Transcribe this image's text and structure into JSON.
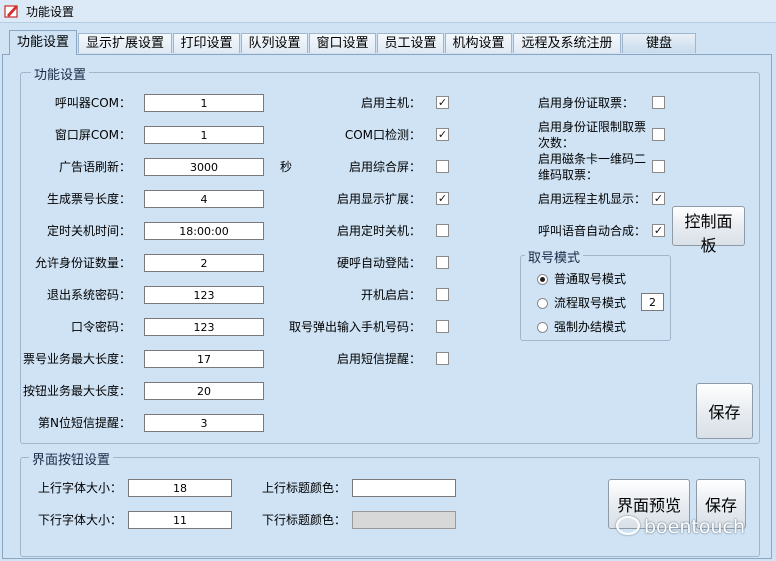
{
  "window": {
    "title": "功能设置"
  },
  "tabs": [
    {
      "label": "功能设置"
    },
    {
      "label": "显示扩展设置"
    },
    {
      "label": "打印设置"
    },
    {
      "label": "队列设置"
    },
    {
      "label": "窗口设置"
    },
    {
      "label": "员工设置"
    },
    {
      "label": "机构设置"
    },
    {
      "label": "远程及系统注册"
    },
    {
      "label": "键盘"
    }
  ],
  "function_group": {
    "title": "功能设置",
    "fields": [
      {
        "label": "呼叫器COM：",
        "value": "1"
      },
      {
        "label": "窗口屏COM：",
        "value": "1"
      },
      {
        "label": "广告语刷新：",
        "value": "3000",
        "unit": "秒"
      },
      {
        "label": "生成票号长度：",
        "value": "4"
      },
      {
        "label": "定时关机时间：",
        "value": "18:00:00"
      },
      {
        "label": "允许身份证数量：",
        "value": "2"
      },
      {
        "label": "退出系统密码：",
        "value": "123"
      },
      {
        "label": "口令密码：",
        "value": "123"
      },
      {
        "label": "票号业务最大长度：",
        "value": "17"
      },
      {
        "label": "按钮业务最大长度：",
        "value": "20"
      },
      {
        "label": "第N位短信提醒：",
        "value": "3"
      }
    ],
    "mid_checks": [
      {
        "label": "启用主机：",
        "checked": true
      },
      {
        "label": "COM口检测：",
        "checked": true
      },
      {
        "label": "启用综合屏：",
        "checked": false
      },
      {
        "label": "启用显示扩展：",
        "checked": true
      },
      {
        "label": "启用定时关机：",
        "checked": false
      },
      {
        "label": "硬呼自动登陆：",
        "checked": false
      },
      {
        "label": "开机启启：",
        "checked": false
      },
      {
        "label": "取号弹出输入手机号码：",
        "checked": false
      },
      {
        "label": "启用短信提醒：",
        "checked": false
      }
    ],
    "right_checks": [
      {
        "label1": "启用身份证取票：",
        "label2": "",
        "checked": false
      },
      {
        "label1": "启用身份证限制取票",
        "label2": "次数：",
        "checked": false
      },
      {
        "label1": "启用磁条卡一维码二",
        "label2": "维码取票：",
        "checked": false
      },
      {
        "label1": "启用远程主机显示：",
        "label2": "",
        "checked": true
      },
      {
        "label1": "呼叫语音自动合成：",
        "label2": "",
        "checked": true
      }
    ],
    "control_panel_button": "控制面板",
    "save_button": "保存",
    "ticket_mode": {
      "title": "取号模式",
      "options": [
        {
          "label": "普通取号模式",
          "selected": true
        },
        {
          "label": "流程取号模式",
          "selected": false,
          "value": "2"
        },
        {
          "label": "强制办结模式",
          "selected": false
        }
      ]
    }
  },
  "button_group": {
    "title": "界面按钮设置",
    "top_font_label": "上行字体大小：",
    "top_font_value": "18",
    "bottom_font_label": "下行字体大小：",
    "bottom_font_value": "11",
    "top_color_label": "上行标题颜色：",
    "top_color_value": "",
    "bottom_color_label": "下行标题颜色：",
    "bottom_color_value": "",
    "preview_button": "界面预览",
    "save_button": "保存"
  },
  "watermark": "boentouch",
  "colors": {
    "background": "#cfe3f5",
    "border": "#9fb6cc"
  }
}
